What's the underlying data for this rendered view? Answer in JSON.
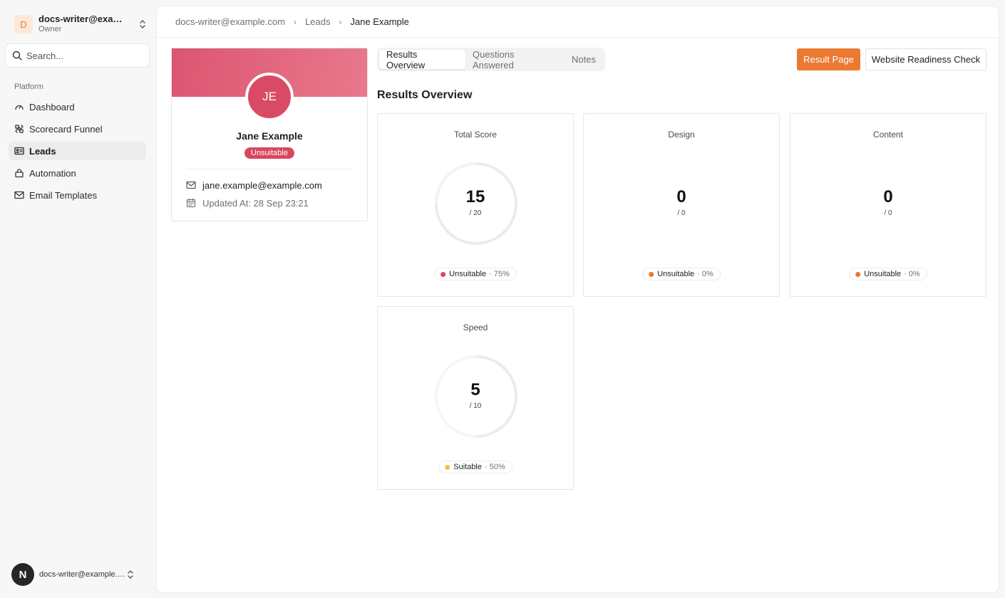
{
  "sidebar": {
    "org": {
      "initial": "D",
      "name": "docs-writer@example.com",
      "role": "Owner"
    },
    "search_placeholder": "Search...",
    "group_label": "Platform",
    "items": [
      {
        "label": "Dashboard",
        "icon": "gauge-icon"
      },
      {
        "label": "Scorecard Funnel",
        "icon": "funnel-icon"
      },
      {
        "label": "Leads",
        "icon": "id-card-icon"
      },
      {
        "label": "Automation",
        "icon": "lock-icon"
      },
      {
        "label": "Email Templates",
        "icon": "mail-icon"
      }
    ],
    "user": {
      "initial": "N",
      "email": "docs-writer@example.com"
    }
  },
  "breadcrumb": [
    "docs-writer@example.com",
    "Leads",
    "Jane Example"
  ],
  "profile": {
    "initials": "JE",
    "name": "Jane Example",
    "status": "Unsuitable",
    "email": "jane.example@example.com",
    "updated": "Updated At: 28 Sep 23:21"
  },
  "tabs": [
    "Results Overview",
    "Questions Answered",
    "Notes"
  ],
  "actions": {
    "result_page": "Result Page",
    "readiness_check": "Website Readiness Check"
  },
  "section_title": "Results Overview",
  "cards": [
    {
      "title": "Total Score",
      "score": "15",
      "max": "/ 20",
      "fraction": 0.75,
      "status": "Unsuitable",
      "percent": "· 75%",
      "color": "#d9475f"
    },
    {
      "title": "Design",
      "score": "0",
      "max": "/ 0",
      "fraction": 0,
      "status": "Unsuitable",
      "percent": "· 0%",
      "color": "#e8772e"
    },
    {
      "title": "Content",
      "score": "0",
      "max": "/ 0",
      "fraction": 0,
      "status": "Unsuitable",
      "percent": "· 0%",
      "color": "#e8772e"
    },
    {
      "title": "Speed",
      "score": "5",
      "max": "/ 10",
      "fraction": 0.5,
      "status": "Suitable",
      "percent": "· 50%",
      "color": "#f5c33b"
    }
  ],
  "colors": {
    "accent": "#ea7a32",
    "unsuitable": "#d9475f",
    "banner": "#dc5571"
  }
}
